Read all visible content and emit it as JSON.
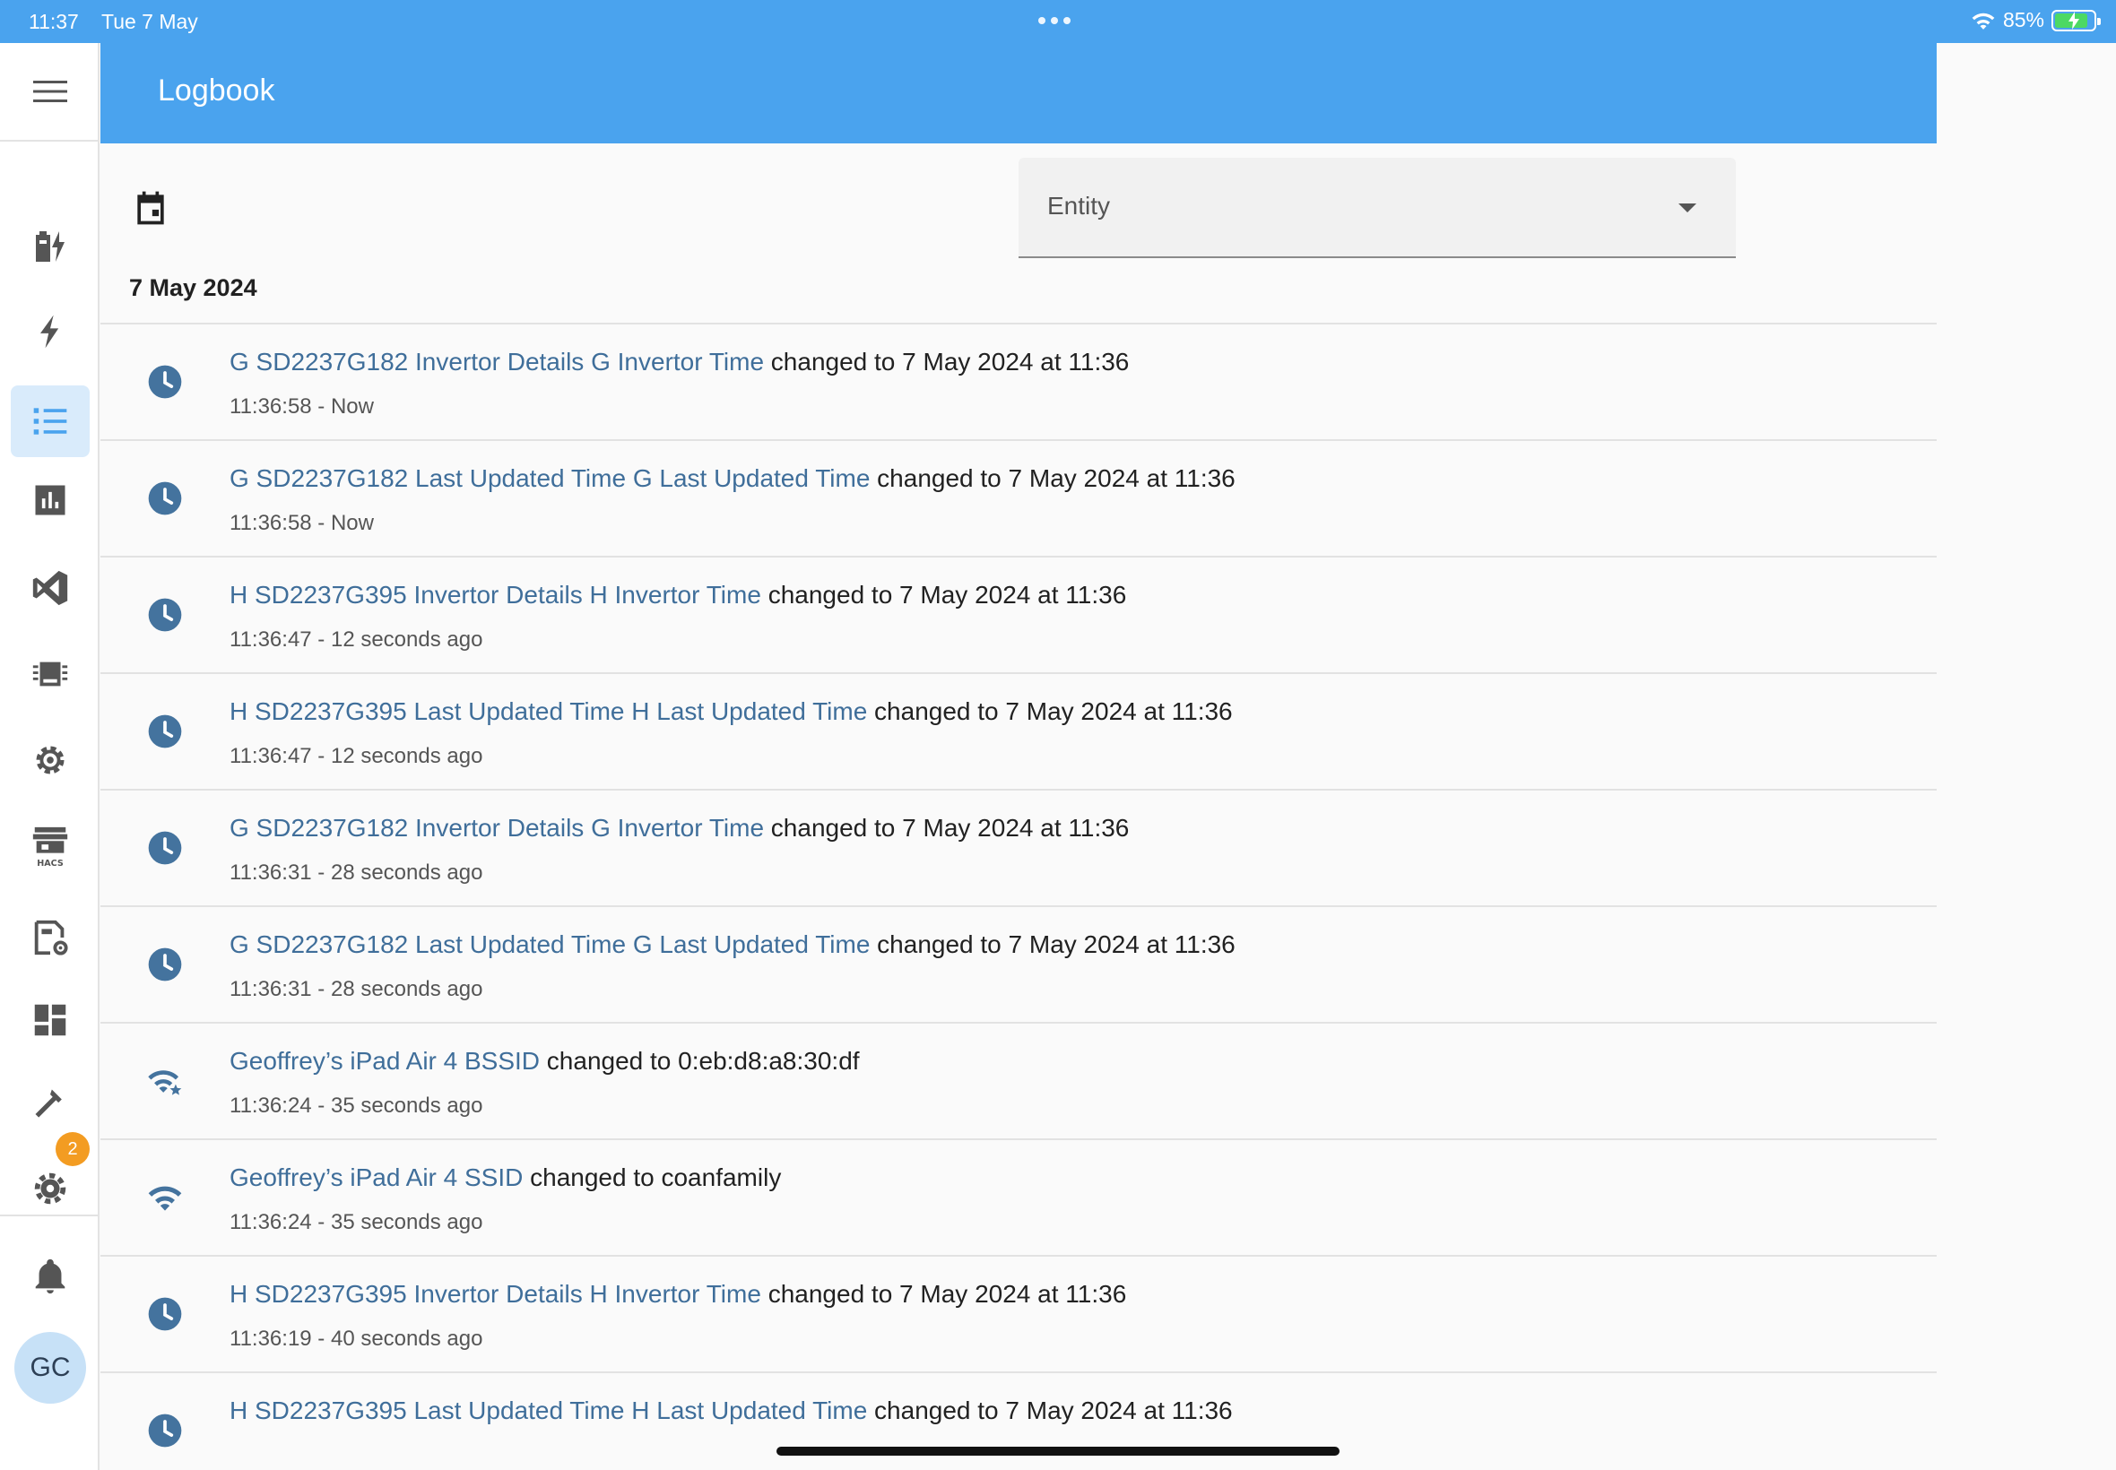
{
  "status_bar": {
    "time": "11:37",
    "date": "Tue 7 May",
    "battery": "85%",
    "battery_level": 0.85
  },
  "header": {
    "title": "Logbook"
  },
  "sidebar": {
    "items": [
      {
        "icon": "battery-charging-icon"
      },
      {
        "icon": "lightning-icon"
      },
      {
        "icon": "logbook-list-icon",
        "active": true
      },
      {
        "icon": "bar-chart-icon"
      },
      {
        "icon": "vscode-icon"
      },
      {
        "icon": "chip-icon"
      },
      {
        "icon": "gear-icon"
      },
      {
        "icon": "hacs-store-icon",
        "label": "HACS"
      },
      {
        "icon": "file-cog-icon"
      },
      {
        "icon": "dashboard-icon"
      },
      {
        "icon": "hammer-icon"
      },
      {
        "icon": "settings-icon"
      }
    ],
    "settings_badge": "2",
    "notifications_icon": "bell-icon",
    "avatar_initials": "GC"
  },
  "filter": {
    "entity_label": "Entity"
  },
  "date_heading": "7 May 2024",
  "log_entries": [
    {
      "icon": "clock-icon",
      "entity": "G SD2237G182 Invertor Details G Invertor Time",
      "message": " changed to 7 May 2024 at 11:36",
      "time": "11:36:58 - Now"
    },
    {
      "icon": "clock-icon",
      "entity": "G SD2237G182 Last Updated Time G Last Updated Time",
      "message": " changed to 7 May 2024 at 11:36",
      "time": "11:36:58 - Now"
    },
    {
      "icon": "clock-icon",
      "entity": "H SD2237G395 Invertor Details H Invertor Time",
      "message": " changed to 7 May 2024 at 11:36",
      "time": "11:36:47 - 12 seconds ago"
    },
    {
      "icon": "clock-icon",
      "entity": "H SD2237G395 Last Updated Time H Last Updated Time",
      "message": " changed to 7 May 2024 at 11:36",
      "time": "11:36:47 - 12 seconds ago"
    },
    {
      "icon": "clock-icon",
      "entity": "G SD2237G182 Invertor Details G Invertor Time",
      "message": " changed to 7 May 2024 at 11:36",
      "time": "11:36:31 - 28 seconds ago"
    },
    {
      "icon": "clock-icon",
      "entity": "G SD2237G182 Last Updated Time G Last Updated Time",
      "message": " changed to 7 May 2024 at 11:36",
      "time": "11:36:31 - 28 seconds ago"
    },
    {
      "icon": "wifi-star-icon",
      "entity": "Geoffrey’s iPad Air 4 BSSID",
      "message": " changed to 0:eb:d8:a8:30:df",
      "time": "11:36:24 - 35 seconds ago"
    },
    {
      "icon": "wifi-icon",
      "entity": "Geoffrey’s iPad Air 4 SSID",
      "message": " changed to coanfamily",
      "time": "11:36:24 - 35 seconds ago"
    },
    {
      "icon": "clock-icon",
      "entity": "H SD2237G395 Invertor Details H Invertor Time",
      "message": " changed to 7 May 2024 at 11:36",
      "time": "11:36:19 - 40 seconds ago"
    },
    {
      "icon": "clock-icon",
      "entity": "H SD2237G395 Last Updated Time H Last Updated Time",
      "message": " changed to 7 May 2024 at 11:36",
      "time": ""
    }
  ],
  "colors": {
    "header": "#4aa3ee",
    "entity_link": "#3f6e9a",
    "icon": "#44739e",
    "active_nav_bg": "#d9ebfb",
    "badge": "#f39c22"
  }
}
